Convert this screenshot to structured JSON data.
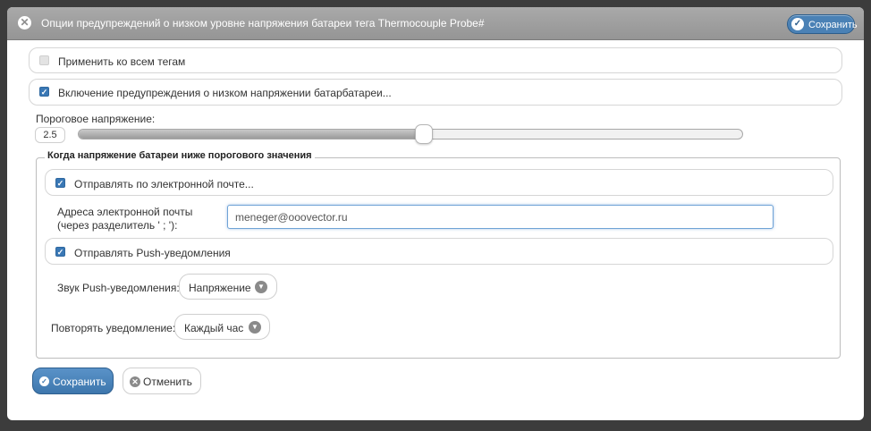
{
  "dialog": {
    "title": "Опции предупреждений о низком уровне напряжения батареи тега Thermocouple Probe#",
    "save_top_label": "Сохранить"
  },
  "apply_all": {
    "label": "Применить ко всем тегам",
    "checked": false
  },
  "enable_warning": {
    "label": "Включение предупреждения о низком напряжении батарбатареи...",
    "checked": true
  },
  "threshold": {
    "label": "Пороговое напряжение:",
    "value": "2.5",
    "slider_fraction": 0.52
  },
  "group": {
    "legend": "Когда напряжение батареи ниже порогового значения",
    "email_toggle": {
      "label": "Отправлять по электронной почте...",
      "checked": true
    },
    "email_label_line1": "Адреса электронной почты",
    "email_label_line2": "(через разделитель ' ; '):",
    "email_value": "meneger@ooovector.ru",
    "push_toggle": {
      "label": "Отправлять Push-уведомления",
      "checked": true
    },
    "push_sound": {
      "label": "Звук Push-уведомления:",
      "value": "Напряжение"
    },
    "repeat": {
      "label": "Повторять уведомление:",
      "value": "Каждый час"
    }
  },
  "footer": {
    "save_label": "Сохранить",
    "cancel_label": "Отменить"
  },
  "icons": {
    "close": "close-circle-icon",
    "check": "check-icon",
    "chevron": "chevron-down-icon",
    "cancel": "cancel-circle-icon"
  },
  "colors": {
    "accent": "#3e77ad",
    "titlebar": "#a0a0a0"
  }
}
